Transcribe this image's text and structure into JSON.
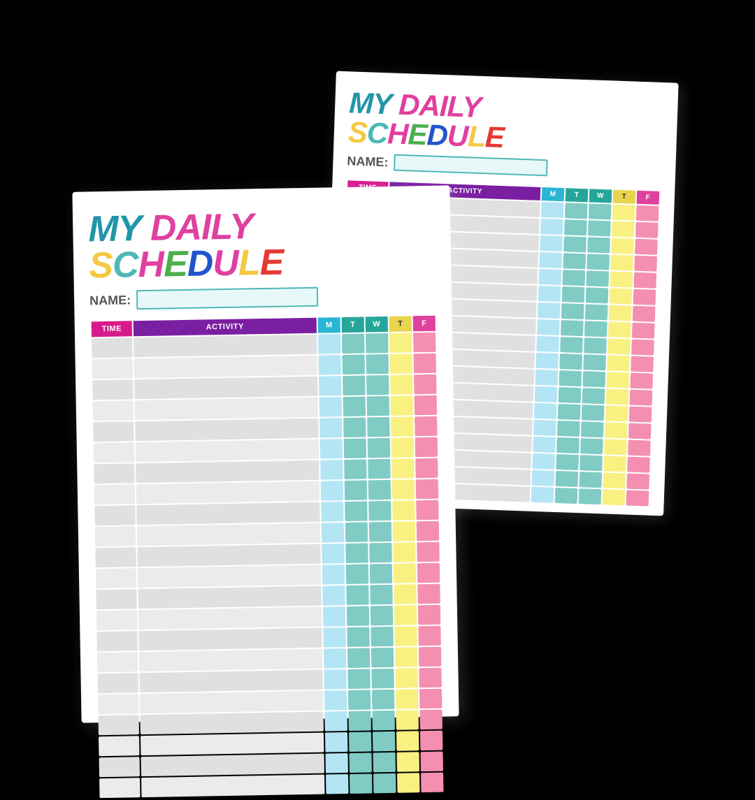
{
  "back_card": {
    "title_my": "MY ",
    "title_daily": "DAILY ",
    "title_schedule": "SCHEDULE",
    "name_label": "NAME:",
    "table_headers": {
      "time": "TIME",
      "activity": "ACTIVITY",
      "m": "M",
      "t": "T",
      "w": "W",
      "th": "T",
      "f": "F"
    },
    "row_count": 18
  },
  "front_card": {
    "title_my": "MY ",
    "title_daily": "DAILY ",
    "title_schedule": "SCHEDULE",
    "name_label": "NAME:",
    "table_headers": {
      "time": "TIME",
      "activity": "ACTIVITY",
      "m": "M",
      "t": "T",
      "w": "W",
      "th": "T",
      "f": "F"
    },
    "row_count": 22
  }
}
